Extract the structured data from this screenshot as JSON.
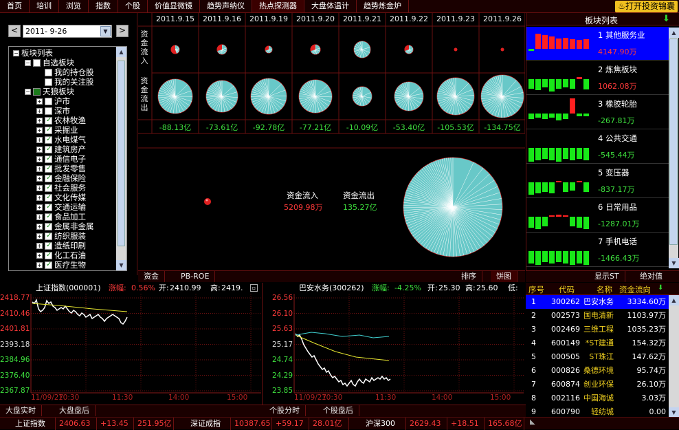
{
  "nav": {
    "tabs": [
      "首页",
      "培训",
      "浏览",
      "指数",
      "个股",
      "价值显微镜",
      "趋势声纳仪",
      "热点探测器",
      "大盘体温计",
      "趋势炼金炉"
    ],
    "active_index": 7,
    "open_button": "打开投资锦囊"
  },
  "left": {
    "date": "2011- 9-26",
    "prev": "<",
    "next": ">",
    "tree": [
      {
        "label": "板块列表",
        "level": 0,
        "pm": "−",
        "check": "none"
      },
      {
        "label": "自选板块",
        "level": 1,
        "pm": "−",
        "check": "box"
      },
      {
        "label": "我的持仓股",
        "level": 2,
        "pm": "",
        "check": "box"
      },
      {
        "label": "我的关注股",
        "level": 2,
        "pm": "",
        "check": "box"
      },
      {
        "label": "天狼板块",
        "level": 1,
        "pm": "−",
        "check": "green"
      },
      {
        "label": "沪市",
        "level": 2,
        "pm": "+",
        "check": "box"
      },
      {
        "label": "深市",
        "level": 2,
        "pm": "+",
        "check": "box"
      },
      {
        "label": "农林牧渔",
        "level": 2,
        "pm": "+",
        "check": "on"
      },
      {
        "label": "采掘业",
        "level": 2,
        "pm": "+",
        "check": "on"
      },
      {
        "label": "水电煤气",
        "level": 2,
        "pm": "+",
        "check": "on"
      },
      {
        "label": "建筑房产",
        "level": 2,
        "pm": "+",
        "check": "on"
      },
      {
        "label": "通信电子",
        "level": 2,
        "pm": "+",
        "check": "on"
      },
      {
        "label": "批发零售",
        "level": 2,
        "pm": "+",
        "check": "on"
      },
      {
        "label": "金融保险",
        "level": 2,
        "pm": "+",
        "check": "on"
      },
      {
        "label": "社会服务",
        "level": 2,
        "pm": "+",
        "check": "on"
      },
      {
        "label": "文化传媒",
        "level": 2,
        "pm": "+",
        "check": "on"
      },
      {
        "label": "交通运输",
        "level": 2,
        "pm": "+",
        "check": "on"
      },
      {
        "label": "食品加工",
        "level": 2,
        "pm": "+",
        "check": "on"
      },
      {
        "label": "金属非金属",
        "level": 2,
        "pm": "+",
        "check": "on"
      },
      {
        "label": "纺织服装",
        "level": 2,
        "pm": "+",
        "check": "on"
      },
      {
        "label": "造纸印刷",
        "level": 2,
        "pm": "+",
        "check": "on"
      },
      {
        "label": "化工石油",
        "level": 2,
        "pm": "+",
        "check": "on"
      },
      {
        "label": "医疗生物",
        "level": 2,
        "pm": "+",
        "check": "on"
      }
    ]
  },
  "heat": {
    "inflow_label": "资金流入",
    "outflow_label": "资金流出",
    "dates": [
      "2011.9.15",
      "2011.9.16",
      "2011.9.19",
      "2011.9.20",
      "2011.9.21",
      "2011.9.22",
      "2011.9.23",
      "2011.9.26"
    ],
    "net": [
      "-88.13亿",
      "-73.61亿",
      "-92.78亿",
      "-77.21亿",
      "-10.09亿",
      "-53.40亿",
      "-105.53亿",
      "-134.75亿"
    ],
    "summary": {
      "in_label": "资金流入",
      "in_value": "5209.98万",
      "out_label": "资金流出",
      "out_value": "135.27亿"
    },
    "tabs": {
      "fund": "资金",
      "pbroe": "PB-ROE",
      "sort": "排序",
      "pie": "饼图"
    }
  },
  "right": {
    "title": "板块列表",
    "cards": [
      {
        "name": "1 其他服务业",
        "value": "4147.90万",
        "neg": false
      },
      {
        "name": "2 炼焦板块",
        "value": "1062.08万",
        "neg": false
      },
      {
        "name": "3 橡胶轮胎",
        "value": "-267.81万",
        "neg": true
      },
      {
        "name": "4 公共交通",
        "value": "-545.44万",
        "neg": true
      },
      {
        "name": "5 变压器",
        "value": "-837.17万",
        "neg": true
      },
      {
        "name": "6 日常用品",
        "value": "-1287.01万",
        "neg": true
      },
      {
        "name": "7 手机电话",
        "value": "-1466.43万",
        "neg": true
      }
    ],
    "tabs": {
      "show_st": "显示ST",
      "abs": "绝对值"
    }
  },
  "chartL": {
    "name": "上证指数(000001)",
    "chg_label": "涨幅:",
    "chg": "0.56%",
    "open_label": "开:",
    "open": "2410.99",
    "high_label": "高:",
    "high": "2419.",
    "y": [
      "2418.77",
      "2410.46",
      "2401.81",
      "2393.18",
      "2384.96",
      "2376.40",
      "2367.87"
    ],
    "x": [
      "11/09/27",
      "10:30",
      "11:30",
      "14:00",
      "15:00"
    ]
  },
  "chartM": {
    "name": "巴安水务(300262)",
    "chg_label": "涨幅:",
    "chg": "-4.25%",
    "open_label": "开:",
    "open": "25.30",
    "high_label": "高:",
    "high": "25.60",
    "low_label": "低:",
    "y": [
      "26.56",
      "26.10",
      "25.63",
      "25.17",
      "24.74",
      "24.29",
      "23.85"
    ],
    "x": [
      "11/09/27",
      "10:30",
      "11:30",
      "14:00",
      "15:00"
    ]
  },
  "table": {
    "headers": [
      "序号",
      "代码",
      "名称",
      "资金流向"
    ],
    "rows": [
      [
        "1",
        "300262",
        "巴安水务",
        "3334.60万"
      ],
      [
        "2",
        "002573",
        "国电清新",
        "1103.97万"
      ],
      [
        "3",
        "002469",
        "三维工程",
        "1035.23万"
      ],
      [
        "4",
        "600149",
        "*ST建通",
        "154.32万"
      ],
      [
        "5",
        "000505",
        "ST珠江",
        "147.62万"
      ],
      [
        "6",
        "000826",
        "桑德环境",
        "95.74万"
      ],
      [
        "7",
        "600874",
        "创业环保",
        "26.10万"
      ],
      [
        "8",
        "002116",
        "中国海诚",
        "3.03万"
      ],
      [
        "9",
        "600790",
        "轻纺城",
        "0.00"
      ]
    ]
  },
  "bottom": {
    "tabs": [
      "大盘实时",
      "大盘盘后",
      "个股分时",
      "个股盘后"
    ],
    "ticker": [
      {
        "name": "上证指数",
        "price": "2406.63",
        "chg": "+13.45",
        "amt": "251.95亿"
      },
      {
        "name": "深证成指",
        "price": "10387.65",
        "chg": "+59.17",
        "amt": "28.01亿"
      },
      {
        "name": "沪深300",
        "price": "2629.43",
        "chg": "+18.51",
        "amt": "165.68亿"
      }
    ]
  }
}
